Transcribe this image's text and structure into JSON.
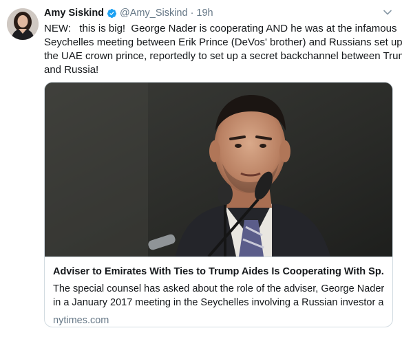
{
  "tweet": {
    "author_name": "Amy Siskind",
    "verified": true,
    "handle": "@Amy_Siskind",
    "separator": "·",
    "timestamp": "19h",
    "text_lines": [
      "NEW:   this is big!  George Nader is cooperating AND he was at the infamous",
      "Seychelles meeting between Erik Prince (DeVos' brother) and Russians set up by",
      "the UAE crown prince, reportedly to set up a secret backchannel between Trump",
      "and Russia!"
    ]
  },
  "card": {
    "title": "Adviser to Emirates With Ties to Trump Aides Is Cooperating With Sp...",
    "description_lines": [
      "The special counsel has asked about the role of the adviser, George Nader,",
      "in a January 2017 meeting in the Seychelles involving a Russian investor a..."
    ],
    "domain": "nytimes.com"
  },
  "icons": {
    "verified": "verified-badge-icon",
    "caret": "chevron-down-icon"
  },
  "colors": {
    "verified_blue": "#1da1f2",
    "secondary_text": "#657786",
    "card_border": "#d2dbe1"
  }
}
